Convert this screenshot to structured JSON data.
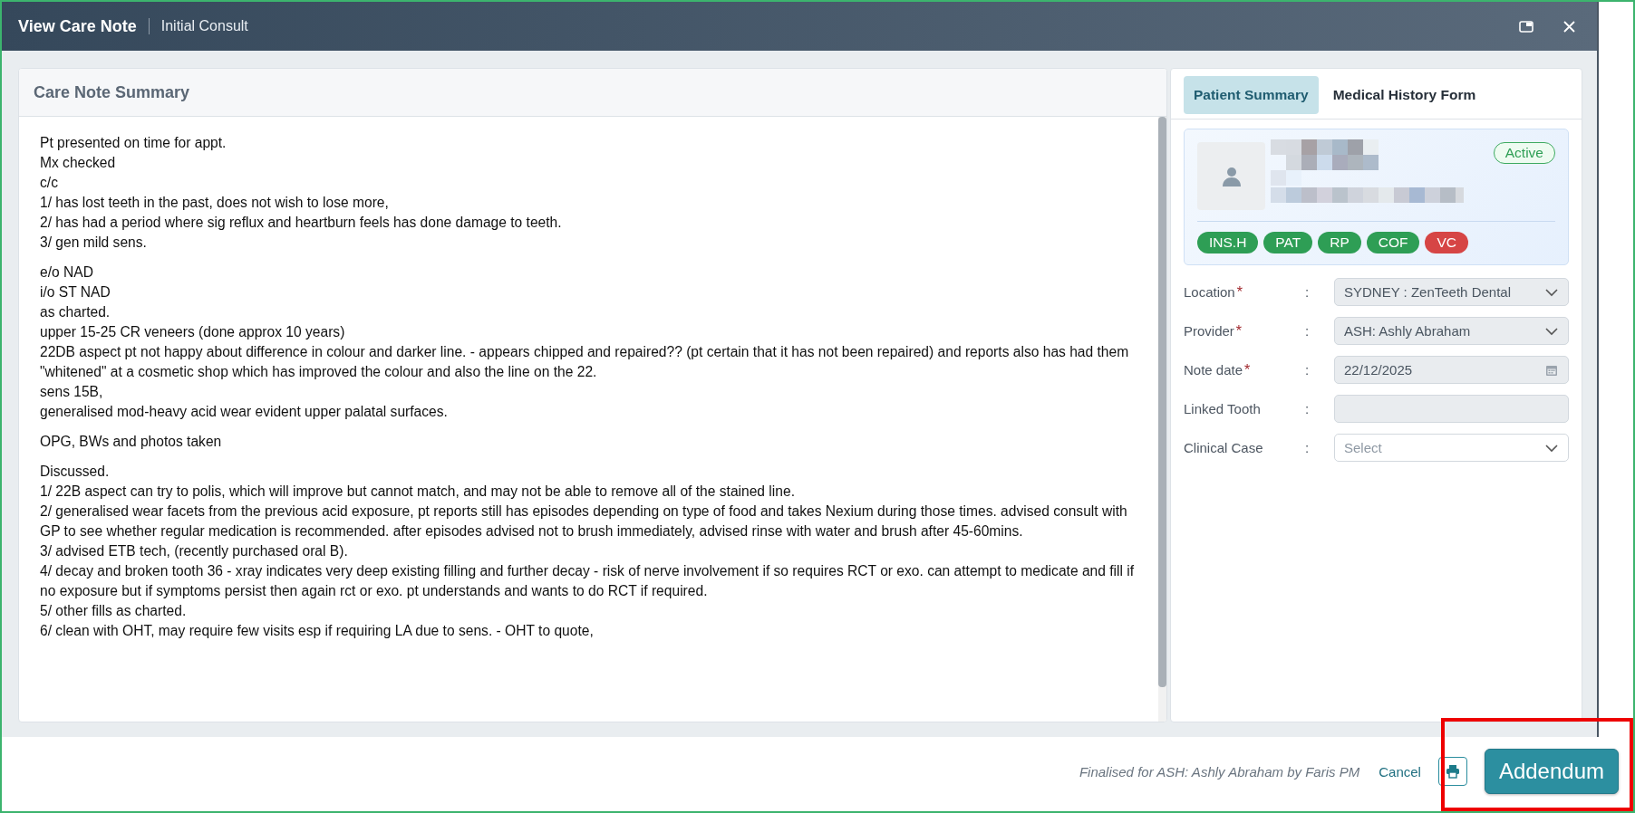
{
  "window": {
    "title": "View Care Note",
    "subtitle": "Initial Consult"
  },
  "note": {
    "title": "Care Note Summary",
    "paragraphs": [
      [
        "Pt presented on time for appt.",
        "Mx checked",
        "c/c",
        "1/ has lost teeth in the past, does not wish to lose more,",
        "2/ has had a period where sig reflux and heartburn feels has done damage to teeth.",
        "3/ gen mild sens."
      ],
      [
        "e/o NAD",
        "i/o ST NAD",
        "as charted.",
        "upper 15-25 CR veneers (done approx 10 years)",
        "22DB aspect pt not happy about difference in colour and darker line.  - appears chipped and repaired?? (pt certain that it has not been repaired) and reports also has had them \"whitened\" at a cosmetic shop which has improved the colour and also the line on the 22.",
        "sens 15B,",
        "generalised mod-heavy acid wear evident upper palatal surfaces."
      ],
      [
        "OPG, BWs and photos taken"
      ],
      [
        "Discussed.",
        "1/ 22B aspect can try to polis, which will improve but cannot match, and may not be able to remove all of the stained line.",
        "2/ generalised wear facets from the previous acid exposure, pt reports still has episodes depending on type of food and takes Nexium during those times. advised consult with GP to see whether regular medication is recommended. after episodes advised not to brush immediately, advised rinse with water and brush after 45-60mins.",
        "3/ advised ETB tech, (recently purchased oral B).",
        "4/ decay and broken tooth 36 - xray indicates very deep existing filling and further decay - risk of nerve involvement if so requires RCT or exo. can attempt to medicate and fill if no exposure but if symptoms persist then again rct or exo. pt understands and wants to do RCT if required.",
        "5/ other fills as charted.",
        "6/ clean with OHT, may require few visits esp if requiring LA due to sens. - OHT to quote,"
      ]
    ]
  },
  "tabs": [
    {
      "label": "Patient Summary",
      "selected": true
    },
    {
      "label": "Medical History Form",
      "selected": false
    }
  ],
  "patient": {
    "status": "Active",
    "tags": [
      {
        "label": "INS.H",
        "color": "#2e9e55"
      },
      {
        "label": "PAT",
        "color": "#2e9e55"
      },
      {
        "label": "RP",
        "color": "#2e9e55"
      },
      {
        "label": "COF",
        "color": "#2e9e55"
      },
      {
        "label": "VC",
        "color": "#d64545"
      }
    ]
  },
  "fields": [
    {
      "label": "Location",
      "required_mark": "*",
      "colon": ":",
      "kind": "select",
      "value": "SYDNEY : ZenTeeth Dental",
      "disabled": true
    },
    {
      "label": "Provider",
      "required_mark": "*",
      "colon": ":",
      "kind": "select",
      "value": "ASH: Ashly Abraham",
      "disabled": true
    },
    {
      "label": "Note date",
      "required_mark": "*",
      "colon": ":",
      "kind": "date",
      "value": "22/12/2025",
      "disabled": true
    },
    {
      "label": "Linked Tooth",
      "colon": ":",
      "kind": "text",
      "disabled": true
    },
    {
      "label": "Clinical Case",
      "colon": ":",
      "kind": "select",
      "placeholder": "Select",
      "disabled": false
    }
  ],
  "footer": {
    "status": "Finalised for ASH: Ashly Abraham by Faris PM",
    "cancel": "Cancel",
    "primary": {
      "label": "Addendum",
      "highlighted": true
    }
  }
}
